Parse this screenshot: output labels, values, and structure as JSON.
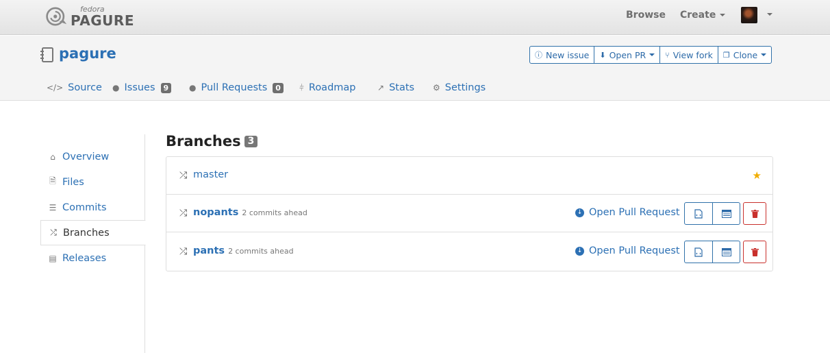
{
  "topbar": {
    "logo": {
      "sub": "fedora",
      "main": "PAGURE"
    },
    "browse": "Browse",
    "create": "Create"
  },
  "repo": {
    "name": "pagure",
    "actions": [
      {
        "label": "New issue",
        "icon": "exclamation-circle-icon"
      },
      {
        "label": "Open PR",
        "icon": "arrow-down-circle-icon"
      },
      {
        "label": "View fork",
        "icon": "fork-icon"
      },
      {
        "label": "Clone",
        "icon": "copy-icon"
      }
    ],
    "tabs": [
      {
        "label": "Source",
        "icon": "code-icon"
      },
      {
        "label": "Issues",
        "icon": "exclamation-circle-icon",
        "count": "9"
      },
      {
        "label": "Pull Requests",
        "icon": "arrow-down-circle-icon",
        "count": "0"
      },
      {
        "label": "Roadmap",
        "icon": "signpost-icon"
      },
      {
        "label": "Stats",
        "icon": "line-chart-icon"
      },
      {
        "label": "Settings",
        "icon": "gears-icon"
      }
    ]
  },
  "sidebar": {
    "items": [
      {
        "label": "Overview",
        "icon": "home-icon"
      },
      {
        "label": "Files",
        "icon": "file-code-icon"
      },
      {
        "label": "Commits",
        "icon": "list-icon"
      },
      {
        "label": "Branches",
        "icon": "random-icon",
        "active": true
      },
      {
        "label": "Releases",
        "icon": "archive-icon"
      }
    ]
  },
  "main": {
    "title": "Branches",
    "count": "3",
    "branches": [
      {
        "name": "master",
        "default": true
      },
      {
        "name": "nopants",
        "ahead": "2 commits ahead",
        "action": "Open Pull Request"
      },
      {
        "name": "pants",
        "ahead": "2 commits ahead",
        "action": "Open Pull Request"
      }
    ]
  },
  "colors": {
    "link": "#2c70b4",
    "star": "#f0ad00",
    "danger": "#c9302c",
    "badge": "#6f6f6f"
  }
}
